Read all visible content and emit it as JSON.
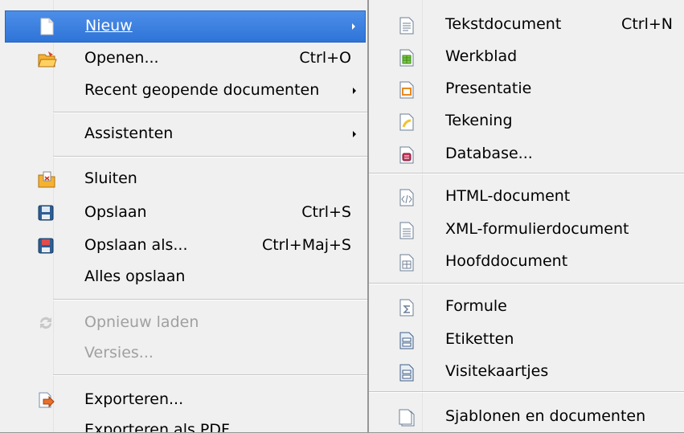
{
  "file_menu": {
    "items": [
      {
        "label": "Nieuw",
        "icon": "new-document-icon"
      },
      {
        "label": "Openen...",
        "shortcut": "Ctrl+O",
        "icon": "open-folder-icon"
      },
      {
        "label": "Recent geopende documenten"
      },
      {
        "label": "Assistenten"
      },
      {
        "label": "Sluiten",
        "icon": "close-folder-icon"
      },
      {
        "label": "Opslaan",
        "shortcut": "Ctrl+S",
        "icon": "save-icon"
      },
      {
        "label": "Opslaan als...",
        "shortcut": "Ctrl+Maj+S",
        "icon": "save-as-icon"
      },
      {
        "label": "Alles opslaan"
      },
      {
        "label": "Opnieuw laden",
        "icon": "reload-icon"
      },
      {
        "label": "Versies..."
      },
      {
        "label": "Exporteren...",
        "icon": "export-icon"
      },
      {
        "label": "Exporteren als PDF"
      }
    ]
  },
  "new_submenu": {
    "items": [
      {
        "label": "Tekstdocument",
        "shortcut": "Ctrl+N",
        "icon": "text-document-icon"
      },
      {
        "label": "Werkblad",
        "icon": "spreadsheet-icon"
      },
      {
        "label": "Presentatie",
        "icon": "presentation-icon"
      },
      {
        "label": "Tekening",
        "icon": "drawing-icon"
      },
      {
        "label": "Database...",
        "icon": "database-icon"
      },
      {
        "label": "HTML-document",
        "icon": "html-document-icon"
      },
      {
        "label": "XML-formulierdocument",
        "icon": "xml-form-document-icon"
      },
      {
        "label": "Hoofddocument",
        "icon": "master-document-icon"
      },
      {
        "label": "Formule",
        "icon": "formula-icon"
      },
      {
        "label": "Etiketten",
        "icon": "labels-icon"
      },
      {
        "label": "Visitekaartjes",
        "icon": "business-cards-icon"
      },
      {
        "label": "Sjablonen en documenten",
        "icon": "templates-icon"
      }
    ]
  },
  "colors": {
    "menu_bg": "#f0f0f0",
    "highlight": "#3a7fe0",
    "disabled_text": "#a0a0a0"
  }
}
